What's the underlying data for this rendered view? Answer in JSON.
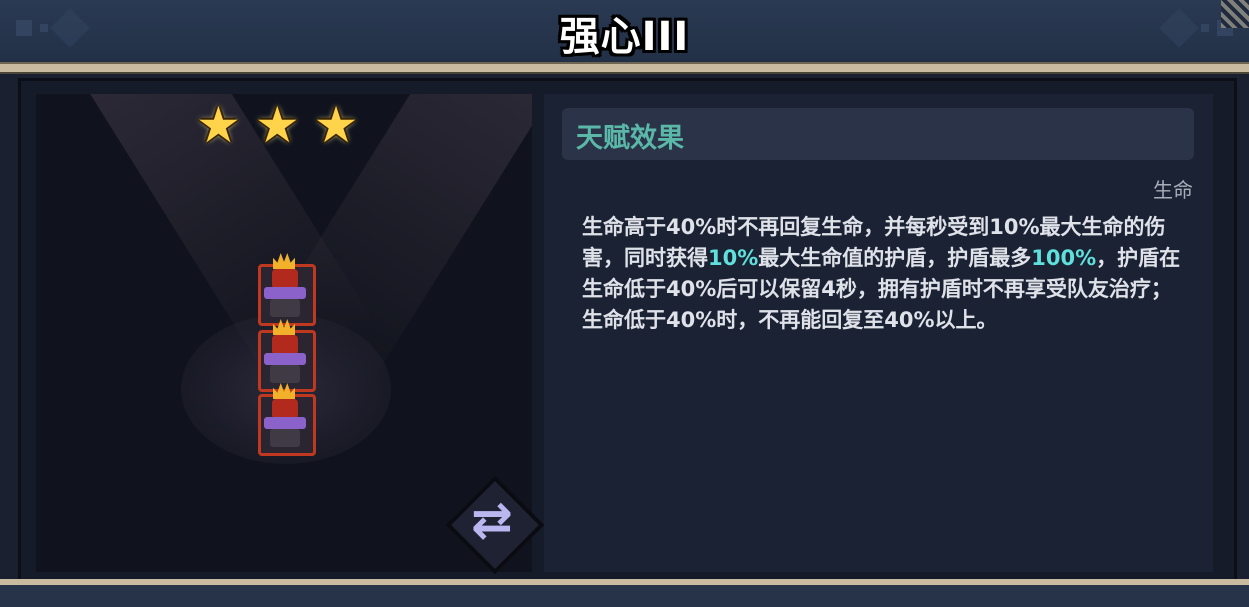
{
  "title": "强心III",
  "stars": {
    "count": 3,
    "glyph": "★"
  },
  "talent": {
    "header": "天赋效果",
    "tag": "生命",
    "description": {
      "p1": "生命高于40%时不再回复生命，并每秒受到10%最大生命的伤害，同时获得",
      "h1": "10%",
      "p2": "最大生命值的护盾，护盾最多",
      "h2": "100%",
      "p3": "，护盾在生命低于40%后可以保留4秒，拥有护盾时不再享受队友治疗；生命低于40%时，不再能回复至40%以上。"
    }
  },
  "units": [
    {
      "name": "unit-1"
    },
    {
      "name": "unit-2"
    },
    {
      "name": "unit-3"
    }
  ],
  "swap_button": {
    "icon": "swap-arrows-icon",
    "glyph": "⇄"
  },
  "colors": {
    "accent_teal": "#5bb8a9",
    "highlight": "#5fe0dc",
    "unit_border": "#c0381f",
    "star": "#ffd34a"
  }
}
